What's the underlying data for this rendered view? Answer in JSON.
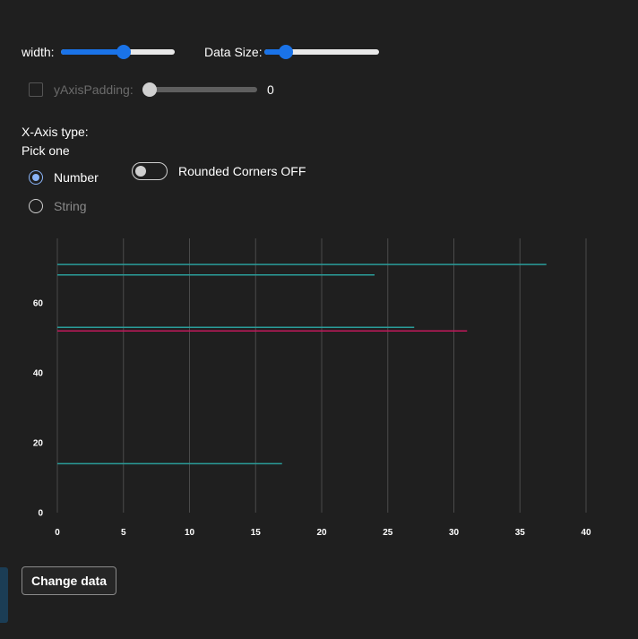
{
  "controls": {
    "width_label": "width:",
    "width_value": 0.56,
    "data_size_label": "Data Size:",
    "data_size_value": 0.14,
    "y_padding_label": "yAxisPadding:",
    "y_padding_checked": false,
    "y_padding_value": 0,
    "y_padding_value_text": "0",
    "x_axis_type_label": "X-Axis type:",
    "pick_one_label": "Pick one",
    "radio_options": [
      {
        "label": "Number",
        "checked": true
      },
      {
        "label": "String",
        "checked": false
      }
    ],
    "rounded_corners_label": "Rounded Corners OFF",
    "rounded_corners_on": false,
    "change_data_label": "Change data"
  },
  "colors": {
    "teal": "#2a9d9a",
    "magenta": "#c2185b",
    "slider_blue": "#1a73e8",
    "grid": "#4a4a4a"
  },
  "chart_data": {
    "type": "bar",
    "orientation": "horizontal",
    "x_ticks": [
      "0",
      "5",
      "10",
      "15",
      "20",
      "25",
      "30",
      "35",
      "40"
    ],
    "y_ticks": [
      "0",
      "20",
      "40",
      "60"
    ],
    "xlim": [
      0,
      40
    ],
    "ylim": [
      0,
      75
    ],
    "grid": "vertical",
    "bars": [
      {
        "y": 71,
        "x": 37,
        "color": "#2a9d9a"
      },
      {
        "y": 68,
        "x": 24,
        "color": "#2a9d9a"
      },
      {
        "y": 53,
        "x": 27,
        "color": "#2a9d9a"
      },
      {
        "y": 52,
        "x": 31,
        "color": "#c2185b"
      },
      {
        "y": 14,
        "x": 17,
        "color": "#2a9d9a"
      }
    ]
  }
}
